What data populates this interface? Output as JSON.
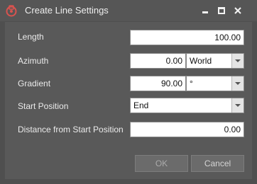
{
  "window": {
    "title": "Create Line Settings",
    "accent_color": "#d9534f"
  },
  "form": {
    "length": {
      "label": "Length",
      "value": "100.00"
    },
    "azimuth": {
      "label": "Azimuth",
      "value": "0.00",
      "unit": "World"
    },
    "gradient": {
      "label": "Gradient",
      "value": "90.00",
      "unit": "°"
    },
    "start_position": {
      "label": "Start Position",
      "value": "End"
    },
    "distance": {
      "label": "Distance from Start Position",
      "value": "0.00"
    }
  },
  "buttons": {
    "ok_label": "OK",
    "cancel_label": "Cancel"
  },
  "icons": {
    "app": "line-tool-icon",
    "minimize": "minimize-icon",
    "maximize": "maximize-icon",
    "close": "close-icon",
    "dropdown": "chevron-down-icon"
  }
}
